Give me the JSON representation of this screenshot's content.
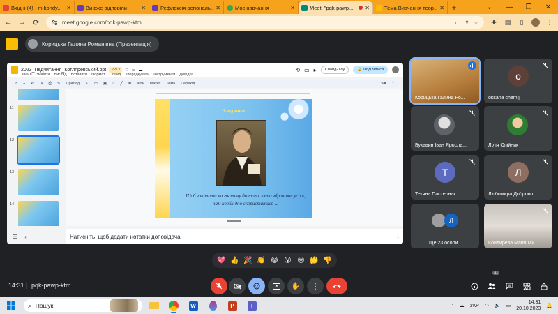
{
  "browser": {
    "tabs": [
      {
        "label": "Вхідні (4) - m.kondy...",
        "color": "#ea4335",
        "active": false
      },
      {
        "label": "Ви вже відповіли",
        "color": "#673ab7",
        "active": false
      },
      {
        "label": "Рефлексія регіональ...",
        "color": "#673ab7",
        "active": false
      },
      {
        "label": "Моє навчання",
        "color": "#34a853",
        "active": false
      },
      {
        "label": "Meet: \"pqk-pawp...",
        "color": "#00897b",
        "active": true
      },
      {
        "label": "Тема Вивчення теор...",
        "color": "#fbbc04",
        "active": false
      }
    ],
    "url": "meet.google.com/pqk-pawp-ktm"
  },
  "presenter": {
    "label": "Корицька Галина Романівна (Презентація)"
  },
  "slides": {
    "file_title": "2023_Педчитання_Котляревський.ppt",
    "badge": ".PPTX",
    "menu": [
      "Файл",
      "Змінити",
      "Вигляд",
      "Вставити",
      "Формат",
      "Слайд",
      "Упорядкувати",
      "Інструменти",
      "Довідка"
    ],
    "slideshow_label": "Слайд-шоу",
    "share_label": "Поділитися",
    "toolbar": [
      "Прилад",
      "Фон",
      "Макет",
      "Тема",
      "Перехід"
    ],
    "thumb_numbers": [
      "",
      "11",
      "12",
      "13",
      "14"
    ],
    "current_slide": {
      "title": "Завдання",
      "quote": "Щоб завітати на гостину до того, «хто зброя нас усіх», нам необхідно скористатися ..."
    },
    "notes_placeholder": "Натисніть, щоб додати нотатки доповідача"
  },
  "participants": [
    {
      "name": "Корицька Галина Ро...",
      "type": "photo",
      "speaking": true
    },
    {
      "name": "oksana chemij",
      "type": "letter",
      "letter": "o",
      "color": "#5d4037",
      "muted": true
    },
    {
      "name": "Букавин Іван Яросла...",
      "type": "photo",
      "muted": true
    },
    {
      "name": "Лілія Опійник",
      "type": "photo",
      "muted": true
    },
    {
      "name": "Тетяна Пастернак",
      "type": "letter",
      "letter": "Т",
      "color": "#5c6bc0",
      "muted": true
    },
    {
      "name": "Любомира Доброво...",
      "type": "letter",
      "letter": "Л",
      "color": "#8d6e63",
      "muted": true
    },
    {
      "name": "Ще 23 особи",
      "type": "others"
    },
    {
      "name": "Кондирева Майя Ми...",
      "type": "photo",
      "muted": true
    }
  ],
  "reactions": [
    "💖",
    "👍",
    "🎉",
    "👏",
    "😂",
    "😮",
    "😢",
    "🤔",
    "👎"
  ],
  "meeting": {
    "time": "14:31",
    "code": "pqk-pawp-ktm",
    "participant_count": "31"
  },
  "taskbar": {
    "search_placeholder": "Пошук",
    "language": "УКР",
    "time": "14:31",
    "date": "20.10.2023"
  },
  "colors": {
    "browser_frame": "#f6a21c",
    "meet_bg": "#202124",
    "end_call": "#ea4335",
    "accent": "#1a73e8"
  }
}
